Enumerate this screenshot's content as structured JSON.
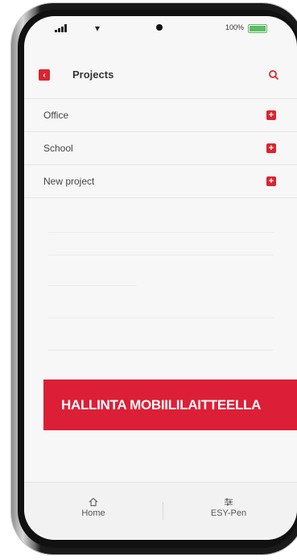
{
  "status_bar": {
    "battery_label": "100%",
    "icons": [
      "signal-icon",
      "wifi-icon",
      "camera-dot",
      "battery-icon"
    ]
  },
  "header": {
    "title": "Projects",
    "back_icon": "chevron-left-icon",
    "search_icon": "search-icon"
  },
  "projects": [
    {
      "label": "Office"
    },
    {
      "label": "School"
    },
    {
      "label": "New project"
    }
  ],
  "banner": {
    "text": "HALLINTA MOBIILILAITTEELLA"
  },
  "bottom_nav": {
    "home_label": "Home",
    "pen_label": "ESY-Pen"
  },
  "colors": {
    "accent": "#d9252f",
    "banner": "#dc1f36",
    "screen_bg": "#f7f7f7"
  }
}
